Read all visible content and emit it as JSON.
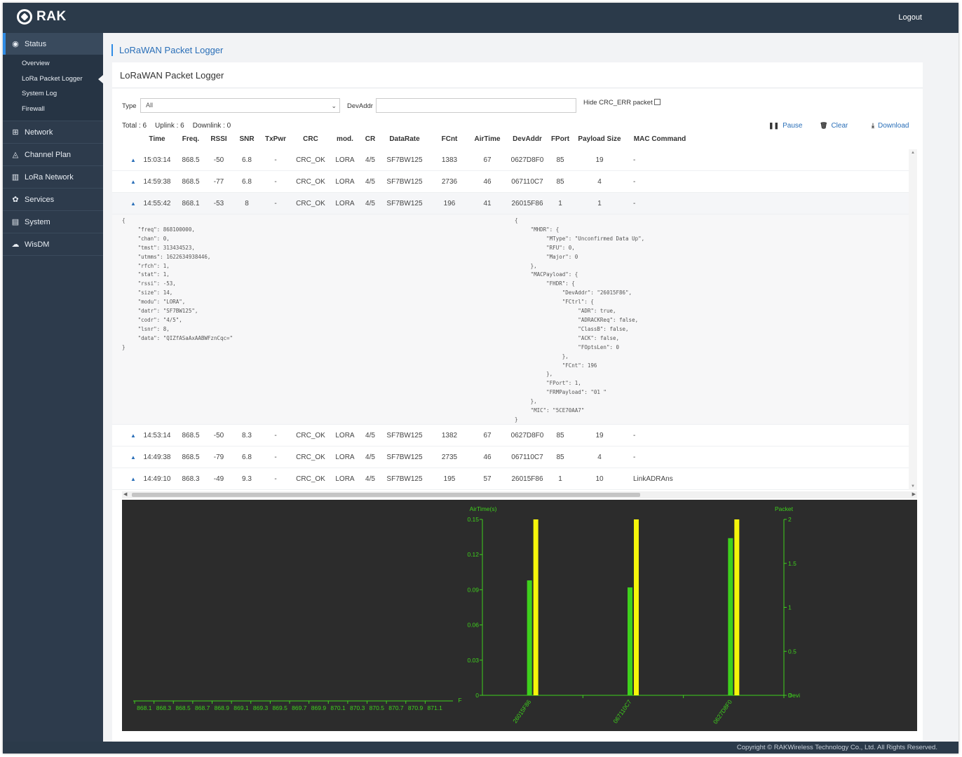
{
  "app": {
    "logo": "RAK",
    "logout": "Logout"
  },
  "sidebar": {
    "status": {
      "label": "Status",
      "items": [
        "Overview",
        "LoRa Packet Logger",
        "System Log",
        "Firewall"
      ]
    },
    "groups": [
      {
        "label": "Network",
        "icon": "network-icon"
      },
      {
        "label": "Channel Plan",
        "icon": "antenna-icon"
      },
      {
        "label": "LoRa Network",
        "icon": "bars-icon"
      },
      {
        "label": "Services",
        "icon": "cogs-icon"
      },
      {
        "label": "System",
        "icon": "system-icon"
      },
      {
        "label": "WisDM",
        "icon": "cloud-icon"
      }
    ]
  },
  "breadcrumb": "LoRaWAN Packet Logger",
  "panel": {
    "title": "LoRaWAN Packet Logger"
  },
  "filters": {
    "type_label": "Type",
    "type_value": "All",
    "devaddr_label": "DevAddr",
    "devaddr_value": "",
    "hide_crc_label": "Hide CRC_ERR packet"
  },
  "counts": {
    "total": "Total : 6",
    "uplink": "Uplink : 6",
    "downlink": "Downlink : 0"
  },
  "actions": {
    "pause": "Pause",
    "clear": "Clear",
    "download": "Download"
  },
  "table": {
    "columns": [
      "Time",
      "Freq.",
      "RSSI",
      "SNR",
      "TxPwr",
      "CRC",
      "mod.",
      "CR",
      "DataRate",
      "FCnt",
      "AirTime",
      "DevAddr",
      "FPort",
      "Payload Size",
      "MAC Command"
    ],
    "rows": [
      [
        "15:03:14",
        "868.5",
        "-50",
        "6.8",
        "-",
        "CRC_OK",
        "LORA",
        "4/5",
        "SF7BW125",
        "1383",
        "67",
        "0627D8F0",
        "85",
        "19",
        "-"
      ],
      [
        "14:59:38",
        "868.5",
        "-77",
        "6.8",
        "-",
        "CRC_OK",
        "LORA",
        "4/5",
        "SF7BW125",
        "2736",
        "46",
        "067110C7",
        "85",
        "4",
        "-"
      ],
      [
        "14:55:42",
        "868.1",
        "-53",
        "8",
        "-",
        "CRC_OK",
        "LORA",
        "4/5",
        "SF7BW125",
        "196",
        "41",
        "26015F86",
        "1",
        "1",
        "-"
      ],
      [
        "14:53:14",
        "868.5",
        "-50",
        "8.3",
        "-",
        "CRC_OK",
        "LORA",
        "4/5",
        "SF7BW125",
        "1382",
        "67",
        "0627D8F0",
        "85",
        "19",
        "-"
      ],
      [
        "14:49:38",
        "868.5",
        "-79",
        "6.8",
        "-",
        "CRC_OK",
        "LORA",
        "4/5",
        "SF7BW125",
        "2735",
        "46",
        "067110C7",
        "85",
        "4",
        "-"
      ],
      [
        "14:49:10",
        "868.3",
        "-49",
        "9.3",
        "-",
        "CRC_OK",
        "LORA",
        "4/5",
        "SF7BW125",
        "195",
        "57",
        "26015F86",
        "1",
        "10",
        "LinkADRAns"
      ]
    ]
  },
  "detail": {
    "rx_json": "{\n     \"freq\": 868100000,\n     \"chan\": 0,\n     \"tmst\": 313434523,\n     \"utmms\": 1622634938446,\n     \"rfch\": 1,\n     \"stat\": 1,\n     \"rssi\": -53,\n     \"size\": 14,\n     \"modu\": \"LORA\",\n     \"datr\": \"SF7BW125\",\n     \"codr\": \"4/5\",\n     \"lsnr\": 8,\n     \"data\": \"QIZfASaAxAABWFznCqc=\"\n}",
    "mac_json": "{\n     \"MHDR\": {\n          \"MType\": \"Unconfirmed Data Up\",\n          \"RFU\": 0,\n          \"Major\": 0\n     },\n     \"MACPayload\": {\n          \"FHDR\": {\n               \"DevAddr\": \"26015F86\",\n               \"FCtrl\": {\n                    \"ADR\": true,\n                    \"ADRACKReq\": false,\n                    \"ClassB\": false,\n                    \"ACK\": false,\n                    \"FOptsLen\": 0\n               },\n               \"FCnt\": 196\n          },\n          \"FPort\": 1,\n          \"FRMPayload\": \"01 \"\n     },\n     \"MIC\": \"5CE70AA7\"\n}"
  },
  "chart_data": [
    {
      "type": "bar",
      "x_label": "F",
      "categories": [
        "868.1",
        "868.3",
        "868.5",
        "868.7",
        "868.9",
        "869.1",
        "869.3",
        "869.5",
        "869.7",
        "869.9",
        "870.1",
        "870.3",
        "870.5",
        "870.7",
        "870.9",
        "871.1"
      ],
      "values": []
    },
    {
      "type": "bar",
      "y_label_left": "AirTime(s)",
      "y_label_right": "Packet",
      "x_label": "Devi",
      "categories": [
        "26015F86",
        "067110C7",
        "0627D8F0"
      ],
      "ylim_left": [
        0,
        0.15
      ],
      "ylim_right": [
        0,
        2
      ],
      "y_ticks_left": [
        "0",
        "0.03",
        "0.06",
        "0.09",
        "0.12",
        "0.15"
      ],
      "y_ticks_right": [
        "0",
        "0.5",
        "1",
        "1.5",
        "2"
      ],
      "series": [
        {
          "name": "AirTime(s)",
          "axis": "left",
          "color": "#3ed11c",
          "values": [
            0.098,
            0.092,
            0.134
          ]
        },
        {
          "name": "Packet",
          "axis": "right",
          "color": "#f5f50a",
          "values": [
            2,
            2,
            2
          ]
        }
      ]
    }
  ],
  "footer": "Copyright © RAKWireless Technology Co., Ltd. All Rights Reserved."
}
